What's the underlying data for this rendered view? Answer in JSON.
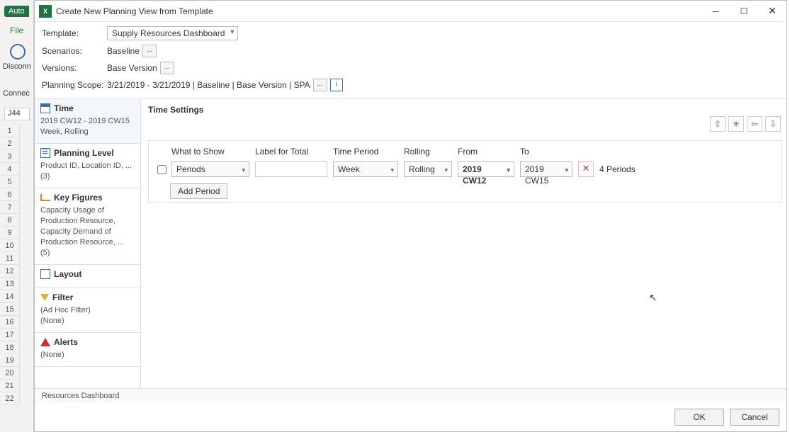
{
  "excel_bg": {
    "auto_tag": "Auto",
    "file_tab": "File",
    "disconnect": "Disconn",
    "connect": "Connec",
    "namebox": "J44",
    "rows": [
      "1",
      "2",
      "3",
      "4",
      "5",
      "6",
      "7",
      "8",
      "9",
      "10",
      "11",
      "12",
      "13",
      "14",
      "15",
      "16",
      "17",
      "18",
      "19",
      "20",
      "21",
      "22"
    ]
  },
  "dialog": {
    "title": "Create New Planning View from Template",
    "header": {
      "template_label": "Template:",
      "template_value": "Supply Resources Dashboard",
      "scenarios_label": "Scenarios:",
      "scenarios_value": "Baseline",
      "versions_label": "Versions:",
      "versions_value": "Base Version",
      "scope_label": "Planning Scope:",
      "scope_value": "3/21/2019 - 3/21/2019 | Baseline | Base Version | SPA",
      "dots": "...",
      "info": "i"
    },
    "sidebar": {
      "time": {
        "title": "Time",
        "line1": "2019 CW12 - 2019 CW15",
        "line2": "Week, Rolling"
      },
      "level": {
        "title": "Planning Level",
        "line1": "Product ID, Location ID, ...",
        "line2": "(3)"
      },
      "key": {
        "title": "Key Figures",
        "line1": "Capacity Usage of Production Resource, Capacity Demand of Production Resource, ... (5)"
      },
      "layout": {
        "title": "Layout"
      },
      "filter": {
        "title": "Filter",
        "line1": "(Ad Hoc Filter)",
        "line2": "(None)"
      },
      "alerts": {
        "title": "Alerts",
        "line1": "(None)"
      }
    },
    "main": {
      "title": "Time Settings",
      "columns": {
        "what": "What to Show",
        "label_total": "Label for Total",
        "period": "Time Period",
        "rolling": "Rolling",
        "from": "From",
        "to": "To",
        "count": ""
      },
      "row": {
        "what": "Periods",
        "label_total": "",
        "period": "Week",
        "rolling": "Rolling",
        "from": "2019 CW12",
        "to": "2019 CW15",
        "delete": "✕",
        "count": "4 Periods"
      },
      "add_period": "Add Period",
      "toolbar": {
        "b1": "⇧",
        "b2": "✳",
        "b3": "⇦",
        "b4": "⇩"
      }
    },
    "sheet_tab": "Resources Dashboard",
    "footer": {
      "ok": "OK",
      "cancel": "Cancel"
    }
  }
}
